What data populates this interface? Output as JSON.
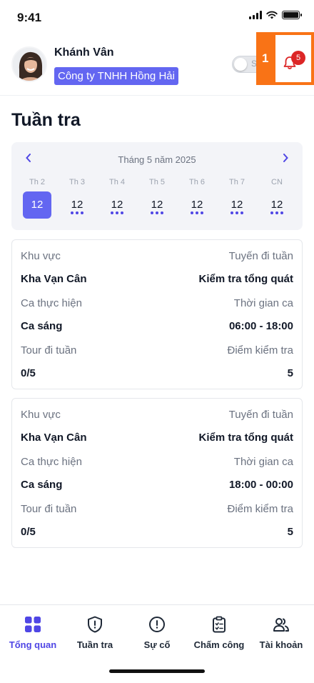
{
  "status_bar": {
    "time": "9:41"
  },
  "header": {
    "user_name": "Khánh Vân",
    "company": "Công ty TNHH Hồng Hải",
    "toggle_label": "S",
    "highlight_label": "1",
    "notification_count": "5"
  },
  "page_title": "Tuần tra",
  "calendar": {
    "month_label": "Tháng 5 năm 2025",
    "days": [
      {
        "dow": "Th 2",
        "date": "12",
        "selected": true
      },
      {
        "dow": "Th 3",
        "date": "12"
      },
      {
        "dow": "Th 4",
        "date": "12"
      },
      {
        "dow": "Th 5",
        "date": "12"
      },
      {
        "dow": "Th 6",
        "date": "12"
      },
      {
        "dow": "Th 7",
        "date": "12"
      },
      {
        "dow": "CN",
        "date": "12"
      }
    ]
  },
  "cards": [
    {
      "area_label": "Khu vực",
      "route_label": "Tuyến đi tuần",
      "area": "Kha Vạn Cân",
      "route": "Kiểm tra tổng quát",
      "shift_label": "Ca thực hiện",
      "shift_time_label": "Thời gian ca",
      "shift": "Ca sáng",
      "shift_time": "06:00 - 18:00",
      "tour_label": "Tour đi tuần",
      "checkpoint_label": "Điểm kiểm tra",
      "tour": "0/5",
      "checkpoints": "5"
    },
    {
      "area_label": "Khu vực",
      "route_label": "Tuyến đi tuần",
      "area": "Kha Vạn Cân",
      "route": "Kiểm tra tổng quát",
      "shift_label": "Ca thực hiện",
      "shift_time_label": "Thời gian ca",
      "shift": "Ca sáng",
      "shift_time": "18:00 - 00:00",
      "tour_label": "Tour đi tuần",
      "checkpoint_label": "Điểm kiểm tra",
      "tour": "0/5",
      "checkpoints": "5"
    }
  ],
  "bottom_nav": [
    {
      "label": "Tổng quan",
      "icon": "grid-icon",
      "active": true
    },
    {
      "label": "Tuần tra",
      "icon": "shield-icon"
    },
    {
      "label": "Sự cố",
      "icon": "alert-circle-icon"
    },
    {
      "label": "Chấm công",
      "icon": "clipboard-icon"
    },
    {
      "label": "Tài khoản",
      "icon": "users-icon"
    }
  ],
  "colors": {
    "accent": "#6366f1",
    "highlight": "#f97316",
    "badge": "#dc2626"
  }
}
